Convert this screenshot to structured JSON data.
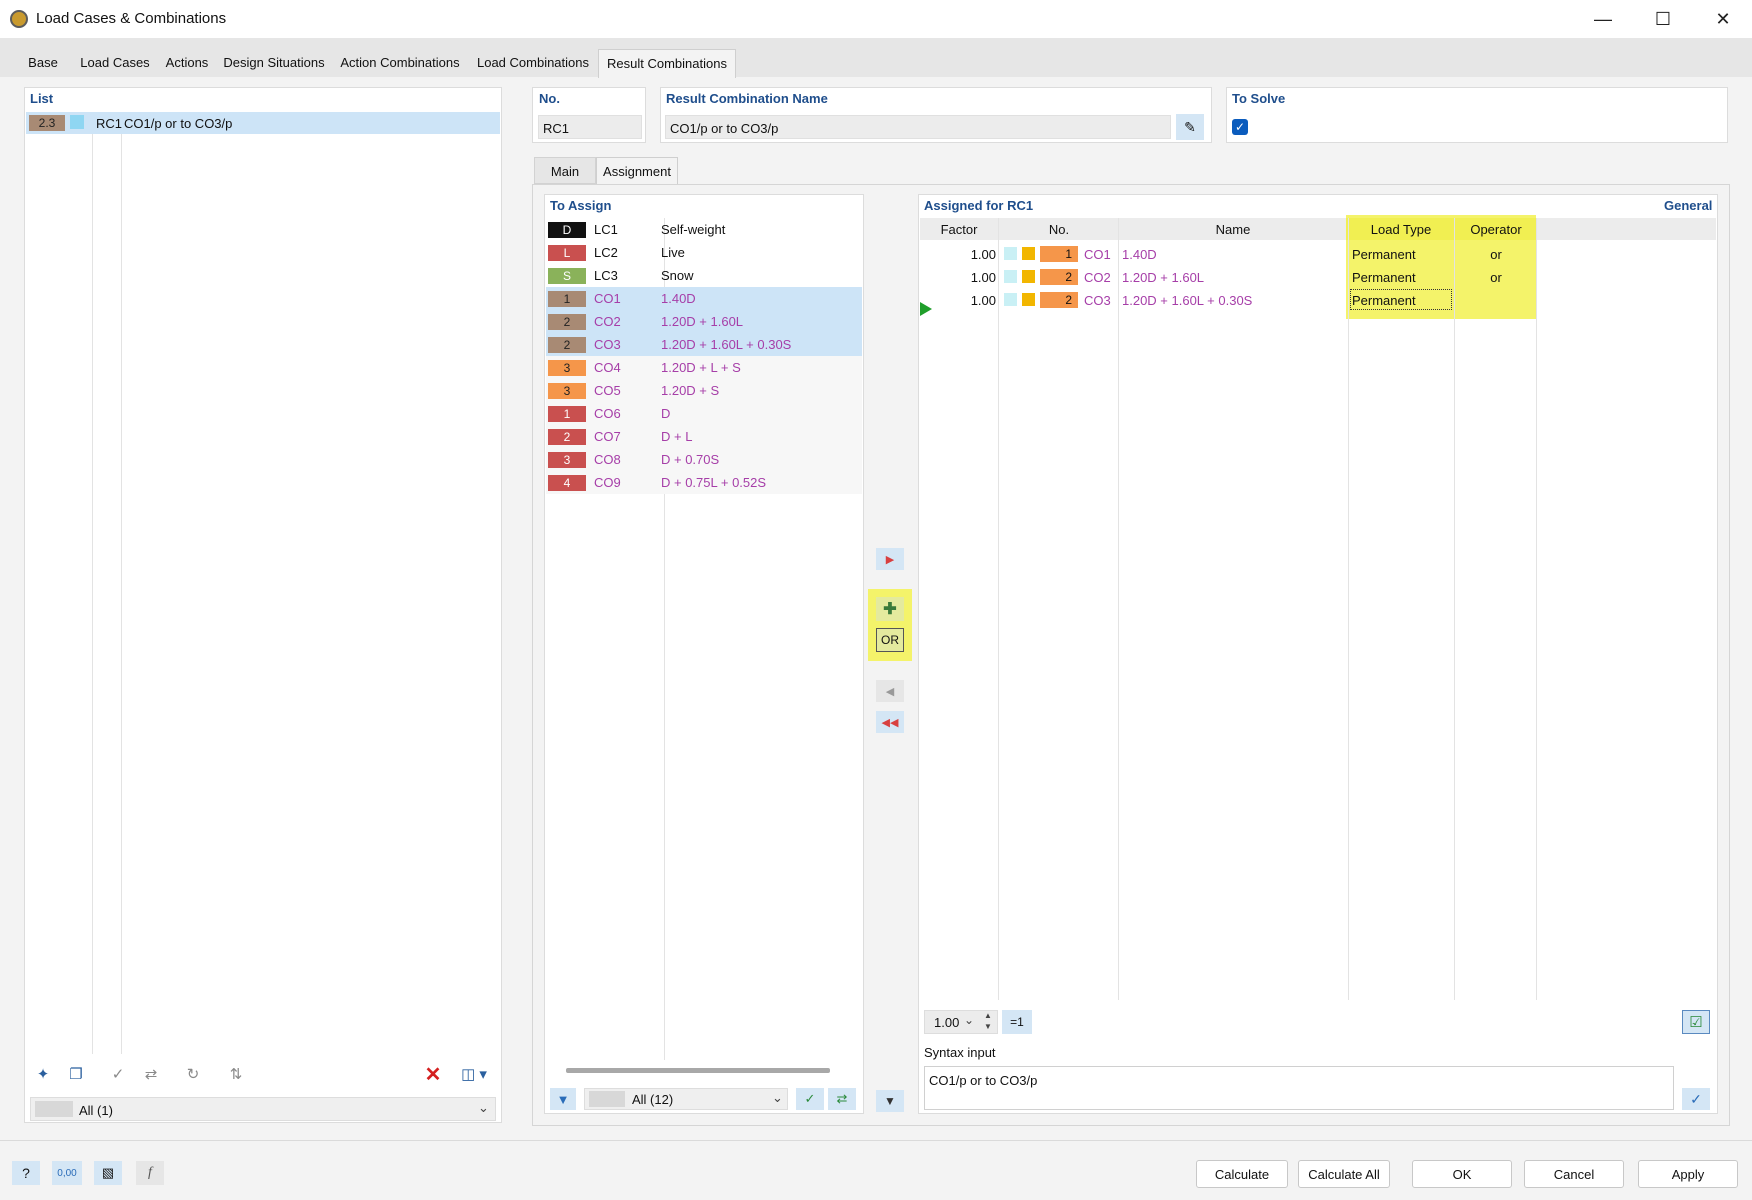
{
  "window": {
    "title": "Load Cases & Combinations"
  },
  "tabs": [
    "Base",
    "Load Cases",
    "Actions",
    "Design Situations",
    "Action Combinations",
    "Load Combinations",
    "Result Combinations"
  ],
  "list": {
    "header": "List",
    "item": {
      "badge": "2.3",
      "id": "RC1",
      "name": "CO1/p or to CO3/p"
    },
    "filter": "All (1)"
  },
  "no": {
    "label": "No.",
    "value": "RC1"
  },
  "rc_name": {
    "label": "Result Combination Name",
    "value": "CO1/p or to CO3/p"
  },
  "to_solve": {
    "label": "To Solve"
  },
  "subtabs": [
    "Main",
    "Assignment"
  ],
  "to_assign": {
    "header": "To Assign",
    "rows": [
      {
        "tag": "D",
        "id": "LC1",
        "name": "Self-weight"
      },
      {
        "tag": "L",
        "id": "LC2",
        "name": "Live"
      },
      {
        "tag": "S",
        "id": "LC3",
        "name": "Snow"
      },
      {
        "tag": "1",
        "id": "CO1",
        "name": "1.40D"
      },
      {
        "tag": "2",
        "id": "CO2",
        "name": "1.20D + 1.60L"
      },
      {
        "tag": "2",
        "id": "CO3",
        "name": "1.20D + 1.60L + 0.30S"
      },
      {
        "tag": "3",
        "id": "CO4",
        "name": "1.20D + L + S"
      },
      {
        "tag": "3",
        "id": "CO5",
        "name": "1.20D + S"
      },
      {
        "tag": "1",
        "id": "CO6",
        "name": "D"
      },
      {
        "tag": "2",
        "id": "CO7",
        "name": "D + L"
      },
      {
        "tag": "3",
        "id": "CO8",
        "name": "D + 0.70S"
      },
      {
        "tag": "4",
        "id": "CO9",
        "name": "D + 0.75L + 0.52S"
      }
    ],
    "filter": "All (12)"
  },
  "mid_buttons": {
    "or_label": "OR"
  },
  "assigned": {
    "header": "Assigned for RC1",
    "general": "General",
    "columns": [
      "Factor",
      "No.",
      "Name",
      "Load Type",
      "Operator"
    ],
    "rows": [
      {
        "factor": "1.00",
        "tag": "1",
        "id": "CO1",
        "name": "1.40D",
        "load_type": "Permanent",
        "operator": "or"
      },
      {
        "factor": "1.00",
        "tag": "2",
        "id": "CO2",
        "name": "1.20D + 1.60L",
        "load_type": "Permanent",
        "operator": "or"
      },
      {
        "factor": "1.00",
        "tag": "2",
        "id": "CO3",
        "name": "1.20D + 1.60L + 0.30S",
        "load_type": "Permanent",
        "operator": ""
      }
    ],
    "factor_input": "1.00",
    "eq1": "=1"
  },
  "syntax": {
    "label": "Syntax input",
    "value": "CO1/p or to CO3/p"
  },
  "bottom_icons": {
    "zero": "0,00"
  },
  "buttons": [
    "Calculate",
    "Calculate All",
    "OK",
    "Cancel",
    "Apply"
  ]
}
